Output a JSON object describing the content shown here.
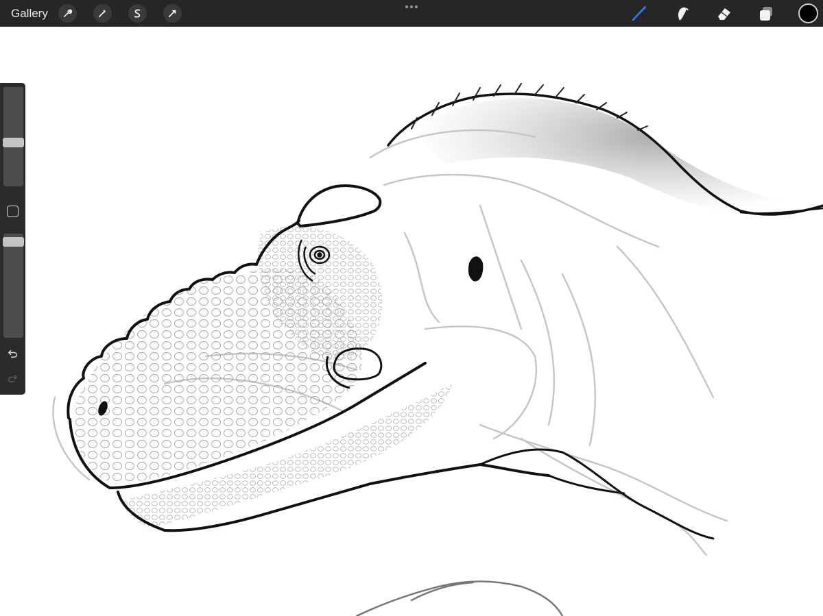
{
  "app": {
    "gallery_label": "Gallery"
  },
  "toolbar_left": {
    "icons": [
      "wrench-icon",
      "magic-wand-icon",
      "selection-s-icon",
      "transform-arrow-icon"
    ]
  },
  "toolbar_right": {
    "tools": [
      "brush-icon",
      "smudge-icon",
      "eraser-icon",
      "layers-icon"
    ],
    "active_tool": "brush",
    "active_tool_color": "#2f7cf6",
    "current_color": "#000000"
  },
  "sidebar": {
    "size_slider_value": 0.57,
    "opacity_slider_value": 1.0,
    "controls": [
      "modify-button",
      "undo-icon",
      "redo-icon"
    ],
    "redo_enabled": false
  },
  "canvas": {
    "background": "#ffffff",
    "subject": "dinosaur-head-sketch"
  }
}
